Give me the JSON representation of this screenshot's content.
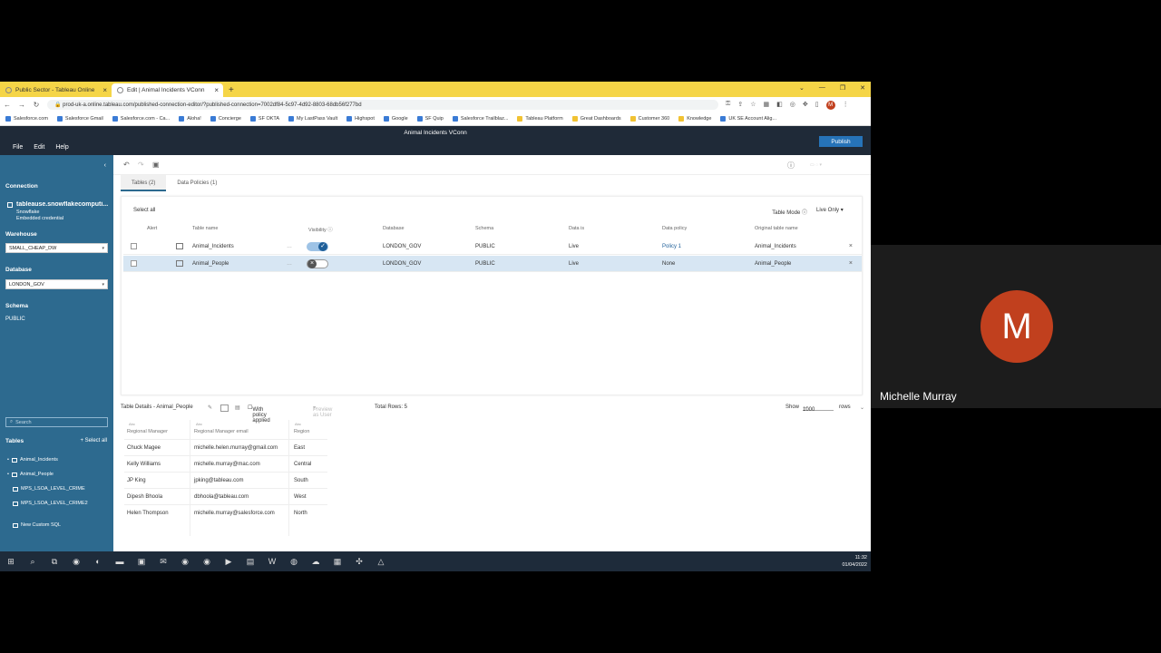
{
  "browser": {
    "tabs": [
      {
        "label": "Public Sector - Tableau Online"
      },
      {
        "label": "Edit | Animal Incidents VConn"
      }
    ],
    "url": "prod-uk-a.online.tableau.com/published-connection-editor/?published-connection=7002df84-5c97-4d92-8803-68db56f277bd",
    "profile_initial": "M",
    "bookmarks": [
      "Salesforce.com",
      "Salesforce Gmail",
      "Salesforce.com - Ca...",
      "Aloha!",
      "Concierge",
      "SF OKTA",
      "My LastPass Vault",
      "Highspot",
      "Google",
      "SF Quip",
      "Salesforce Trailblaz...",
      "Tableau Platform",
      "Great Dashboards",
      "Customer 360",
      "Knowledge",
      "UK SE Account Alig..."
    ]
  },
  "app": {
    "doc_title": "Animal Incidents VConn",
    "menu": [
      "File",
      "Edit",
      "Help"
    ],
    "publish_label": "Publish"
  },
  "left": {
    "connection_header": "Connection",
    "connection_name": "tableause.snowflakecomputi...",
    "connection_type": "Snowflake",
    "connection_cred": "Embedded credential",
    "warehouse_header": "Warehouse",
    "warehouse_value": "SMALL_CHEAP_DW",
    "database_header": "Database",
    "database_value": "LONDON_GOV",
    "schema_header": "Schema",
    "schema_value": "PUBLIC",
    "search_placeholder": "Search",
    "tables_header": "Tables",
    "select_all": "Select all",
    "tables": [
      "Animal_Incidents",
      "Animal_People",
      "MPS_LSOA_LEVEL_CRIME",
      "MPS_LSOA_LEVEL_CRIME2"
    ],
    "custom_sql": "New Custom SQL"
  },
  "main": {
    "subtabs": [
      "Tables (2)",
      "Data Policies (1)"
    ],
    "select_all": "Select all",
    "table_mode_label": "Table Mode",
    "table_mode_value": "Live Only",
    "headers": [
      "Alert",
      "Table name",
      "Visibility",
      "Database",
      "Schema",
      "Data is",
      "Data policy",
      "Original table name"
    ],
    "rows": [
      {
        "name": "Animal_Incidents",
        "visible": true,
        "database": "LONDON_GOV",
        "schema": "PUBLIC",
        "data_is": "Live",
        "policy": "Policy 1",
        "original": "Animal_Incidents"
      },
      {
        "name": "Animal_People",
        "visible": false,
        "database": "LONDON_GOV",
        "schema": "PUBLIC",
        "data_is": "Live",
        "policy": "None",
        "original": "Animal_People"
      }
    ]
  },
  "details": {
    "title": "Table Details - Animal_People",
    "with_policy": "With policy applied",
    "preview_as": "Preview as User",
    "total_rows": "Total Rows: 5",
    "show_label": "Show",
    "show_value": "1000",
    "rows_label": "rows",
    "type_label": "Abc",
    "columns": [
      "Regional Manager",
      "Regional Manager email",
      "Region"
    ],
    "data": [
      [
        "Chuck Magee",
        "michelle.helen.murray@gmail.com",
        "East"
      ],
      [
        "Kelly Williams",
        "michelle.murray@mac.com",
        "Central"
      ],
      [
        "JP King",
        "jpking@tableau.com",
        "South"
      ],
      [
        "Dipesh Bhoola",
        "dbhoola@tableau.com",
        "West"
      ],
      [
        "Helen Thompson",
        "michelle.murray@salesforce.com",
        "North"
      ]
    ]
  },
  "taskbar": {
    "time": "11:32",
    "date": "01/04/2022"
  },
  "video": {
    "initial": "M",
    "name": "Michelle Murray",
    "avatar_color": "#c1401e"
  }
}
